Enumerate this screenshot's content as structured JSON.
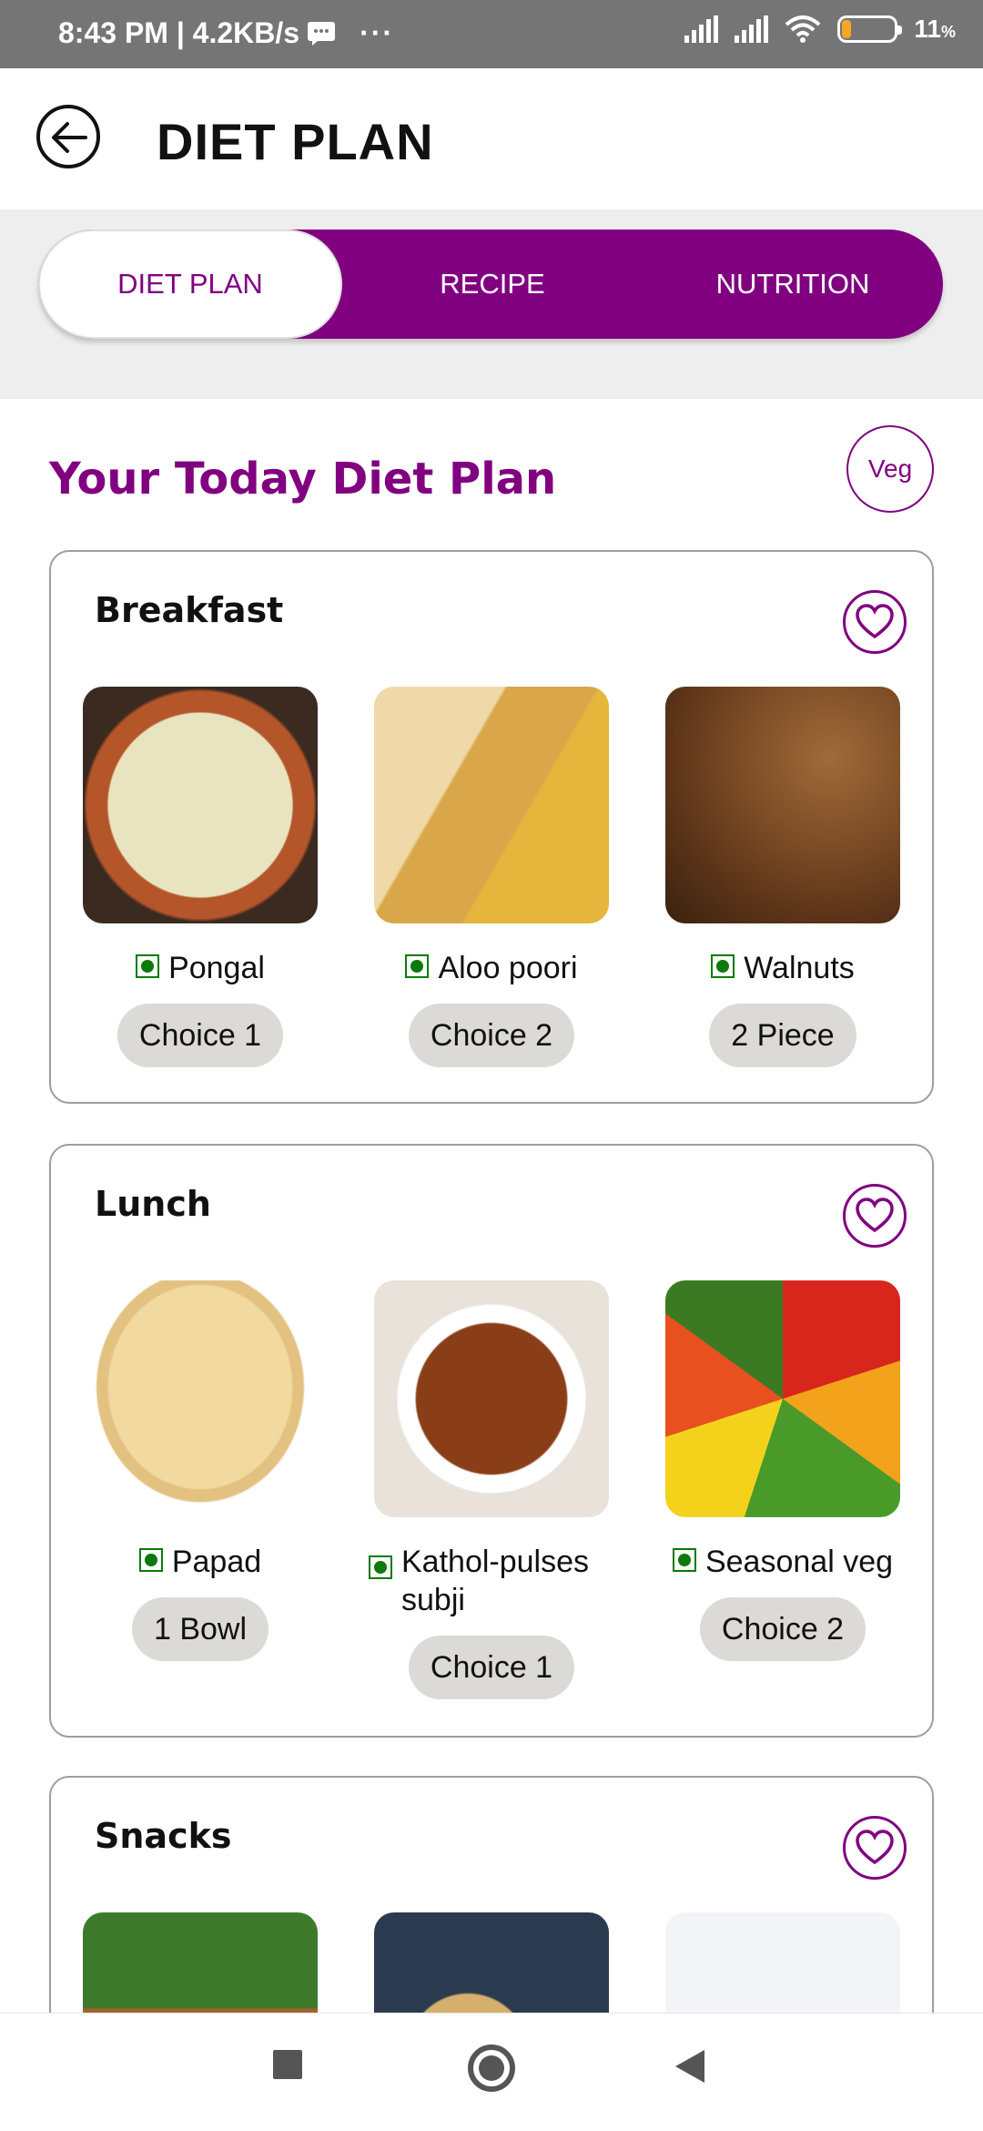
{
  "status_bar": {
    "time_info": "8:43 PM | 4.2KB/s",
    "more": "···",
    "battery": "11",
    "battery_unit": "%"
  },
  "header": {
    "title": "DIET PLAN",
    "back_icon": "arrow-left-icon"
  },
  "tabs": [
    {
      "label": "DIET PLAN",
      "active": true
    },
    {
      "label": "RECIPE",
      "active": false
    },
    {
      "label": "NUTRITION",
      "active": false
    }
  ],
  "section": {
    "title": "Your Today Diet Plan",
    "filter_label": "Veg"
  },
  "meals": [
    {
      "title": "Breakfast",
      "items": [
        {
          "name": "Pongal",
          "qty": "Choice 1"
        },
        {
          "name": "Aloo poori",
          "qty": "Choice 2"
        },
        {
          "name": "Walnuts",
          "qty": "2 Piece"
        }
      ]
    },
    {
      "title": "Lunch",
      "items": [
        {
          "name": "Papad",
          "qty": "1 Bowl"
        },
        {
          "name": "Kathol-pulses subji",
          "qty": "Choice 1"
        },
        {
          "name": "Seasonal veg",
          "qty": "Choice 2"
        }
      ]
    },
    {
      "title": "Snacks",
      "items": []
    }
  ],
  "colors": {
    "accent": "#800080",
    "veg_mark": "#0a7a0a",
    "pill_bg": "#dcdad6"
  },
  "nav": {
    "recents_icon": "square-icon",
    "home_icon": "circle-home-icon",
    "back_icon": "triangle-back-icon"
  }
}
